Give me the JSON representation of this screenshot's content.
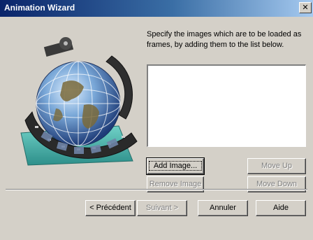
{
  "window": {
    "title": "Animation Wizard",
    "close_glyph": "✕"
  },
  "instructions": "Specify the images which are to be loaded as frames, by adding them to the list below.",
  "list": {
    "items": []
  },
  "buttons": {
    "add_image": "Add Image...",
    "remove_image": "Remove Image",
    "move_up": "Move Up",
    "move_down": "Move Down",
    "back": "< Précédent",
    "next": "Suivant >",
    "cancel": "Annuler",
    "help": "Aide"
  },
  "illustration": {
    "icon": "globe-with-film-strip-icon"
  },
  "colors": {
    "title_bar_start": "#0a246a",
    "title_bar_end": "#a6caf0",
    "face": "#d4d0c8"
  }
}
